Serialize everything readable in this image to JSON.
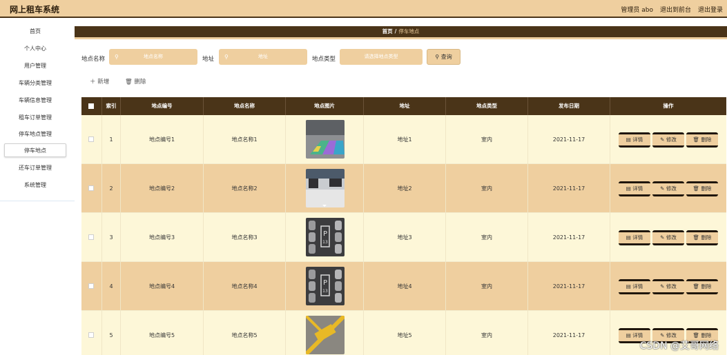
{
  "header": {
    "app_title": "网上租车系统",
    "links": [
      "管理员 abo",
      "退出到前台",
      "退出登录"
    ]
  },
  "sidebar": {
    "items": [
      {
        "label": "首页"
      },
      {
        "label": "个人中心"
      },
      {
        "label": "用户管理"
      },
      {
        "label": "车辆分类管理"
      },
      {
        "label": "车辆信息管理"
      },
      {
        "label": "租车订单管理"
      },
      {
        "label": "停车地点管理"
      },
      {
        "label": "停车地点"
      },
      {
        "label": "还车订单管理"
      },
      {
        "label": "系统管理"
      }
    ],
    "active_index": 7
  },
  "breadcrumb": {
    "home": "首页",
    "separator": "/",
    "current": "停车地点"
  },
  "search": {
    "name_label": "地点名称",
    "name_placeholder": "地点名称",
    "address_label": "地址",
    "address_placeholder": "地址",
    "type_label": "地点类型",
    "type_placeholder": "请选择地点类型",
    "query_button": "查询"
  },
  "actions": {
    "add": "新增",
    "delete": "删除"
  },
  "table": {
    "columns": [
      "索引",
      "地点编号",
      "地点名称",
      "地点图片",
      "地址",
      "地点类型",
      "发布日期",
      "操作"
    ],
    "rows": [
      {
        "index": "1",
        "code": "地点编号1",
        "name": "地点名称1",
        "address": "地址1",
        "type": "室内",
        "date": "2021-11-17",
        "image": "parking-lot-colored-lanes"
      },
      {
        "index": "2",
        "code": "地点编号2",
        "name": "地点名称2",
        "address": "地址2",
        "type": "室内",
        "date": "2021-11-17",
        "image": "garage-entrance"
      },
      {
        "index": "3",
        "code": "地点编号3",
        "name": "地点名称3",
        "address": "地址3",
        "type": "室内",
        "date": "2021-11-17",
        "image": "parking-aerial-p13"
      },
      {
        "index": "4",
        "code": "地点编号4",
        "name": "地点名称4",
        "address": "地址4",
        "type": "室内",
        "date": "2021-11-17",
        "image": "parking-aerial-p13"
      },
      {
        "index": "5",
        "code": "地点编号5",
        "name": "地点名称5",
        "address": "地址5",
        "type": "室内",
        "date": "2021-11-17",
        "image": "yellow-parking-marking"
      }
    ],
    "row_buttons": {
      "detail": "详情",
      "edit": "修改",
      "delete": "删除"
    }
  },
  "watermark": "CSDN @艾哥网络",
  "colors": {
    "accent": "#efcf9f",
    "dark": "#4a3418",
    "row_odd": "#fdf7d8",
    "row_even": "#efcf9f"
  }
}
